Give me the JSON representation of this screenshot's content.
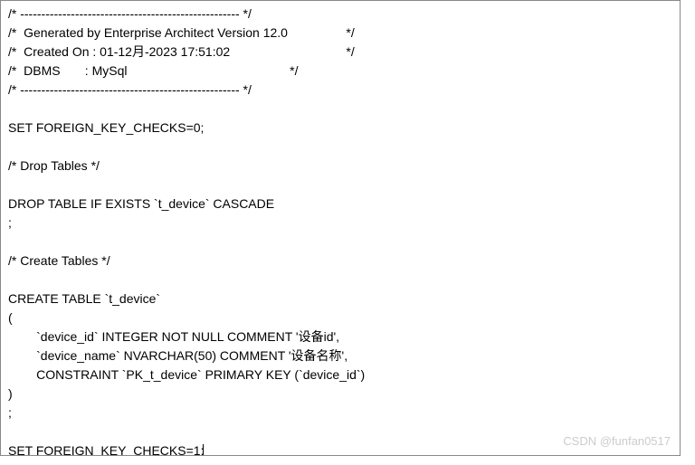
{
  "lines": {
    "l1": "/* ---------------------------------------------------- */",
    "l2": "/*  Generated by Enterprise Architect Version 12.0 \t\t*/",
    "l3": "/*  Created On : 01-12月-2023 17:51:02 \t\t\t\t*/",
    "l4": "/*  DBMS       : MySql \t\t\t\t\t\t*/",
    "l5": "/* ---------------------------------------------------- */",
    "l6": "",
    "l7": "SET FOREIGN_KEY_CHECKS=0;",
    "l8": "",
    "l9": "/* Drop Tables */",
    "l10": "",
    "l11": "DROP TABLE IF EXISTS `t_device` CASCADE",
    "l12": ";",
    "l13": "",
    "l14": "/* Create Tables */",
    "l15": "",
    "l16": "CREATE TABLE `t_device`",
    "l17": "(",
    "l18": "\t`device_id` INTEGER NOT NULL COMMENT '设备id',",
    "l19": "\t`device_name` NVARCHAR(50) COMMENT '设备名称',",
    "l20": "\tCONSTRAINT `PK_t_device` PRIMARY KEY (`device_id`)",
    "l21": ")",
    "l22": ";",
    "l23": "",
    "l24_prefix": "SET FOREIGN_KEY_CHECKS=1;"
  },
  "watermark": "CSDN @funfan0517"
}
